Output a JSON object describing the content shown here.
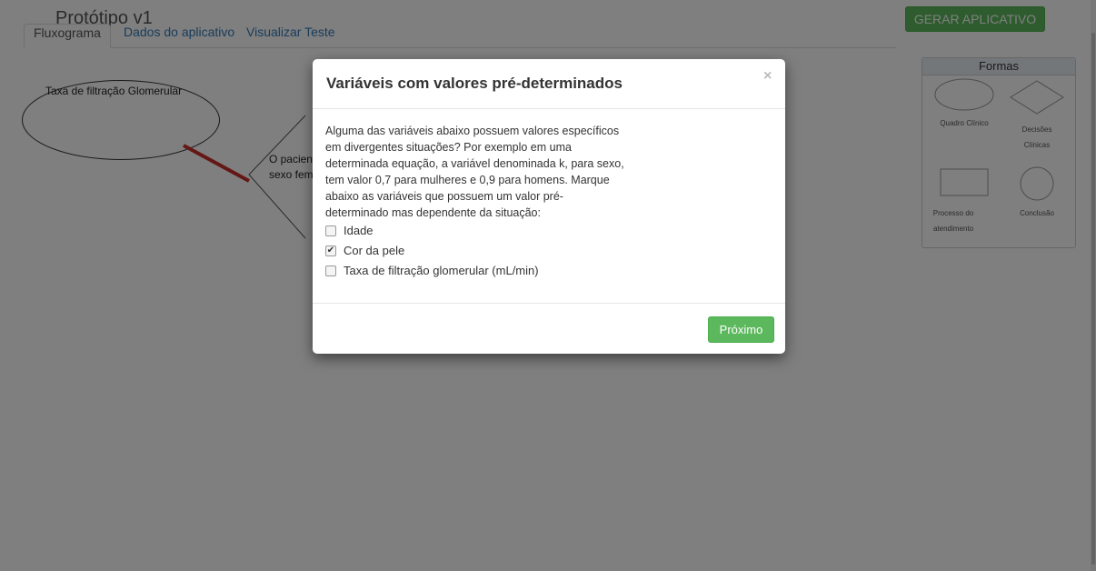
{
  "header": {
    "app_title": "Protótipo v1",
    "generate_button": "GERAR APLICATIVO"
  },
  "tabs": [
    {
      "label": "Fluxograma",
      "active": true
    },
    {
      "label": "Dados do aplicativo",
      "active": false
    },
    {
      "label": "Visualizar Teste",
      "active": false
    }
  ],
  "canvas": {
    "ellipse_label": "Taxa de filtração Glomerular",
    "diamond_label_line1": "O paciente",
    "diamond_label_line2": "sexo femin"
  },
  "palette": {
    "title": "Formas",
    "items": [
      {
        "label": "Quadro Clínico",
        "icon": "ellipse-shape-icon"
      },
      {
        "label": "Decisões Clínicas",
        "icon": "diamond-shape-icon"
      },
      {
        "label": "Processo do atendimento",
        "icon": "rectangle-shape-icon"
      },
      {
        "label": "Conclusão",
        "icon": "circle-shape-icon"
      }
    ]
  },
  "modal": {
    "title": "Variáveis com valores pré-determinados",
    "close_symbol": "×",
    "description": "Alguma das variáveis abaixo possuem valores específicos\nem divergentes situações? Por exemplo em uma\ndeterminada equação, a variável denominada k, para sexo,\ntem valor 0,7 para mulheres e 0,9 para homens. Marque\nabaixo as variáveis que possuem um valor pré-\ndeterminado mas dependente da situação:",
    "options": [
      {
        "label": "Idade",
        "checked": false
      },
      {
        "label": "Cor da pele",
        "checked": true
      },
      {
        "label": "Taxa de filtração glomerular (mL/min)",
        "checked": false
      }
    ],
    "next_button": "Próximo"
  },
  "colors": {
    "accent_green": "#5cb85c",
    "link_blue": "#337ab7",
    "connector_red": "#c9302c",
    "overlay": "rgba(0,0,0,0.5)"
  }
}
